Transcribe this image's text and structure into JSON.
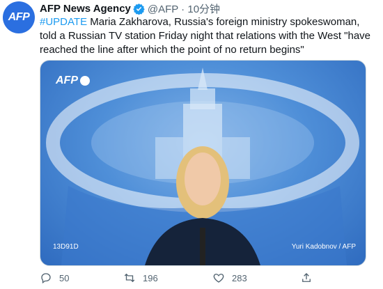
{
  "account": {
    "avatar_text": "AFP",
    "name": "AFP News Agency",
    "handle": "@AFP · 10分钟"
  },
  "tweet": {
    "hashtag": "#UPDATE",
    "text": " Maria Zakharova, Russia's foreign ministry spokeswoman, told a Russian TV station Friday night that relations with the West \"have reached the line after which the point of no return begins\""
  },
  "media": {
    "logo_text": "AFP",
    "caption_left": "13D91D",
    "caption_right": "Yuri Kadobnov / AFP"
  },
  "actions": {
    "reply_count": "50",
    "retweet_count": "196",
    "like_count": "283"
  },
  "colors": {
    "link": "#1d9bf0",
    "muted": "#536471",
    "avatar": "#2b6fe0"
  }
}
